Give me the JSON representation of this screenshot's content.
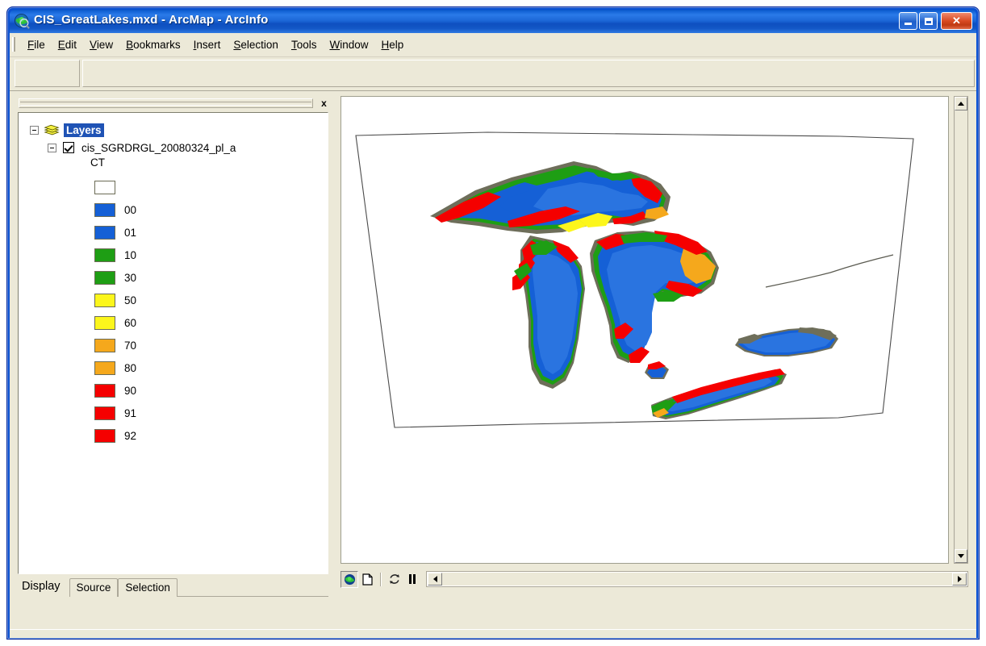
{
  "window": {
    "title": "CIS_GreatLakes.mxd - ArcMap - ArcInfo",
    "app_icon": "arcmap-globe-icon",
    "controls": {
      "minimize": "minimize-button",
      "restore": "restore-button",
      "close": "close-button"
    }
  },
  "menu": {
    "items": [
      {
        "label": "File",
        "accel": "F"
      },
      {
        "label": "Edit",
        "accel": "E"
      },
      {
        "label": "View",
        "accel": "V"
      },
      {
        "label": "Bookmarks",
        "accel": "B"
      },
      {
        "label": "Insert",
        "accel": "I"
      },
      {
        "label": "Selection",
        "accel": "S"
      },
      {
        "label": "Tools",
        "accel": "T"
      },
      {
        "label": "Window",
        "accel": "W"
      },
      {
        "label": "Help",
        "accel": "H"
      }
    ]
  },
  "toc": {
    "close_label": "x",
    "root": {
      "label": "Layers",
      "icon": "stacked-layers-icon",
      "expanded": true,
      "selected": true
    },
    "layer": {
      "label": "cis_SGRDRGL_20080324_pl_a",
      "checked": true,
      "expanded": true,
      "field": "CT"
    },
    "legend": [
      {
        "label": "",
        "color": "#ffffff"
      },
      {
        "label": "00",
        "color": "#1560d6"
      },
      {
        "label": "01",
        "color": "#1560d6"
      },
      {
        "label": "10",
        "color": "#1e9e14"
      },
      {
        "label": "30",
        "color": "#1e9e14"
      },
      {
        "label": "50",
        "color": "#fcf61c"
      },
      {
        "label": "60",
        "color": "#fcf61c"
      },
      {
        "label": "70",
        "color": "#f5a81c"
      },
      {
        "label": "80",
        "color": "#f5a81c"
      },
      {
        "label": "90",
        "color": "#f50000"
      },
      {
        "label": "91",
        "color": "#f50000"
      },
      {
        "label": "92",
        "color": "#f50000"
      }
    ],
    "tabs": [
      {
        "label": "Display",
        "active": true
      },
      {
        "label": "Source",
        "active": false
      },
      {
        "label": "Selection",
        "active": false
      }
    ]
  },
  "map": {
    "background": "#ffffff",
    "boundary_color": "#4b4b4b",
    "colors": {
      "water": "#1560d6",
      "ice_green": "#1e9e14",
      "ice_yellow": "#fcf61c",
      "ice_orange": "#f5a81c",
      "ice_red": "#f50000",
      "ice_gray": "#6e6e5a"
    },
    "bottom_bar": {
      "data_view_button": "globe-icon",
      "layout_view_button": "page-icon",
      "refresh_button": "refresh-icon",
      "pause_button": "pause-icon",
      "scroll_left": "arrow-left-icon",
      "scroll_right": "arrow-right-icon"
    },
    "vertical_scrollbar": {
      "up": "arrow-up-icon",
      "down": "arrow-down-icon"
    }
  }
}
